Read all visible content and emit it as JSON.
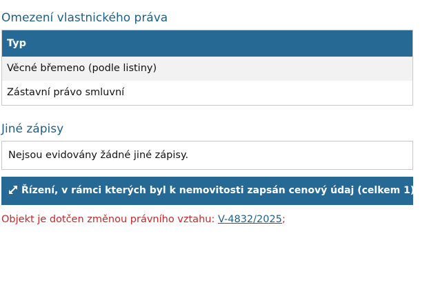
{
  "restrictions_section": {
    "title": "Omezení vlastnického práva",
    "table": {
      "header": "Typ",
      "rows": [
        "Věcné břemeno (podle listiny)",
        "Zástavní právo smluvní"
      ]
    }
  },
  "other_records_section": {
    "title": "Jiné zápisy",
    "message": "Nejsou evidovány žádné jiné zápisy."
  },
  "proceedings_panel": {
    "icon": "expand-arrows-icon",
    "label": "Řízení, v rámci kterých byl k nemovitosti zapsán cenový údaj (celkem 1)"
  },
  "notice": {
    "text": "Objekt je dotčen změnou právního vztahu: ",
    "link_text": "V-4832/2025",
    "suffix": ";"
  },
  "colors": {
    "heading": "#1f5f86",
    "header_bg": "#256994",
    "alert_text": "#c62828"
  }
}
